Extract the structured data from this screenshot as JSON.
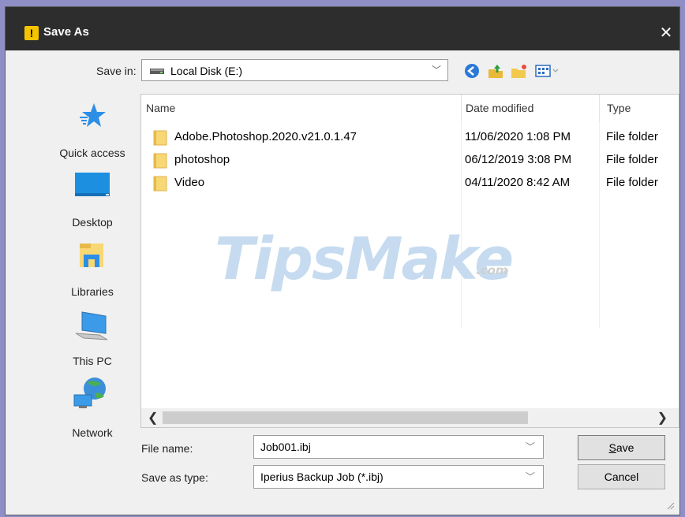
{
  "window": {
    "title": "Save As",
    "close_label": "✕"
  },
  "savein": {
    "label": "Save in:",
    "value": "Local Disk (E:)"
  },
  "places": [
    {
      "label": "Quick access",
      "icon": "quick-access-star-icon"
    },
    {
      "label": "Desktop",
      "icon": "desktop-icon"
    },
    {
      "label": "Libraries",
      "icon": "libraries-icon"
    },
    {
      "label": "This PC",
      "icon": "this-pc-icon"
    },
    {
      "label": "Network",
      "icon": "network-icon"
    }
  ],
  "columns": [
    "Name",
    "Date modified",
    "Type"
  ],
  "files": [
    {
      "name": "Adobe.Photoshop.2020.v21.0.1.47",
      "date": "11/06/2020 1:08 PM",
      "type": "File folder"
    },
    {
      "name": "photoshop",
      "date": "06/12/2019 3:08 PM",
      "type": "File folder"
    },
    {
      "name": "Video",
      "date": "04/11/2020 8:42 AM",
      "type": "File folder"
    }
  ],
  "watermark": {
    "text": "TipsMake",
    "suffix": ".com"
  },
  "form": {
    "filename_label": "File name:",
    "filename_value": "Job001.ibj",
    "savetype_label": "Save as type:",
    "savetype_value": "Iperius Backup Job (*.ibj)"
  },
  "buttons": {
    "save_rest": "ave",
    "save_mnemonic": "S",
    "cancel": "Cancel"
  },
  "colors": {
    "titlebar": "#2d2d2d",
    "accent": "#f5c400",
    "folder": "#f8d775"
  }
}
